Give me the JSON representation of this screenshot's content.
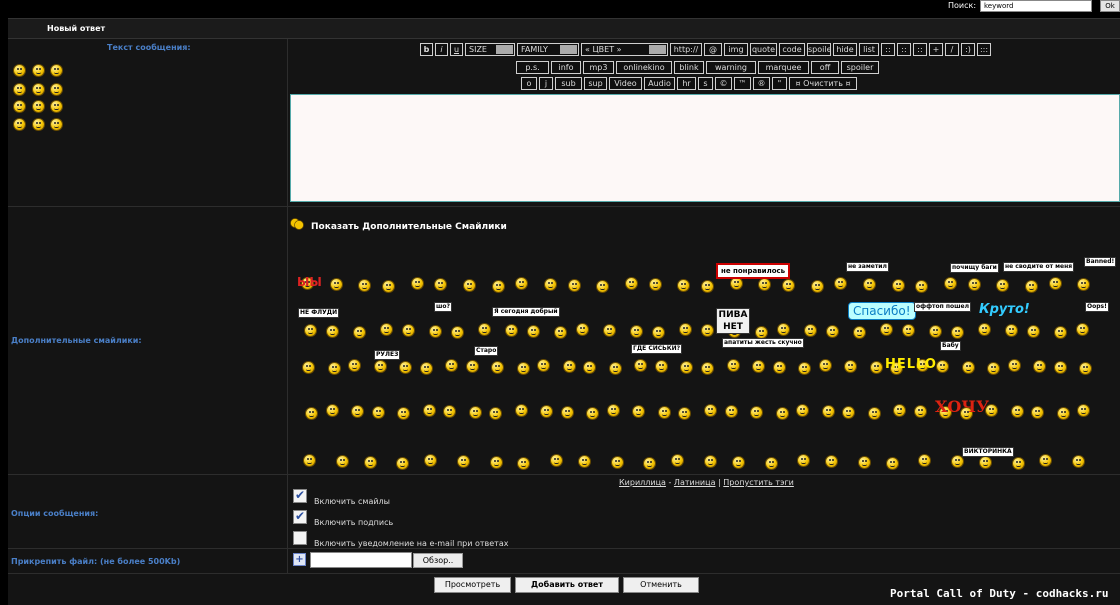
{
  "search": {
    "label": "Поиск:",
    "value": "keyword",
    "button": "Ok"
  },
  "header": {
    "title": "Новый ответ"
  },
  "message": {
    "label": "Текст сообщения:"
  },
  "toolbar_row1": [
    "b",
    "i",
    "u",
    "SIZE",
    "FAMILY",
    "« ЦВЕТ »",
    "http://",
    "@",
    "img",
    "quote",
    "code",
    "spoile",
    "hide",
    "list",
    "::",
    "::",
    "::",
    "+",
    "/",
    ":)",
    ":::"
  ],
  "toolbar_row2": [
    "p.s.",
    "info",
    "mp3",
    "onlinekino",
    "blink",
    "warning",
    "marquee",
    "off",
    "spoiler"
  ],
  "toolbar_row3": [
    "o",
    "j",
    "sub",
    "sup",
    "Video",
    "Audio",
    "hr",
    "s",
    "©",
    "™",
    "®",
    "\"",
    "¤ Очистить ¤"
  ],
  "extra_smileys": {
    "label": "Дополнительные смайлики:",
    "show_more": "Показать Дополнительные Смайлики",
    "signs": [
      "ЫЫ",
      "не понравилось",
      "не заметил",
      "почищу баги",
      "не сводите от меня",
      "Banned!",
      "НЕ ФЛУДИ",
      "шо?",
      "Я сегодня добрый",
      "ПИВА НЕТ",
      "Спасибо!",
      "оффтоп пошел",
      "Круто!",
      "Oops!",
      "РУЛЕЗ",
      "Старо",
      "ГДЕ СИСЬКИ?",
      "апатиты жесть скучно",
      "HELLO",
      "Бабу",
      "ХОЧУ",
      "ВИКТОРИНКА"
    ]
  },
  "links": {
    "a": "Кириллица",
    "sep1": "-",
    "b": "Латиница",
    "sep2": "|",
    "c": "Пропустить тэги"
  },
  "options": {
    "label": "Опции сообщения:",
    "items": [
      {
        "label": "Включить смайлы",
        "checked": true
      },
      {
        "label": "Включить подпись",
        "checked": true
      },
      {
        "label": "Включить уведомление на e-mail при ответах",
        "checked": false
      }
    ]
  },
  "attach": {
    "label": "Прикрепить файл: (не более 500Kb)",
    "browse": "Обзор..",
    "plus": "+"
  },
  "buttons": {
    "preview": "Просмотреть",
    "submit": "Добавить ответ",
    "cancel": "Отменить"
  },
  "watermark": "Portal Call of Duty - codhacks.ru"
}
